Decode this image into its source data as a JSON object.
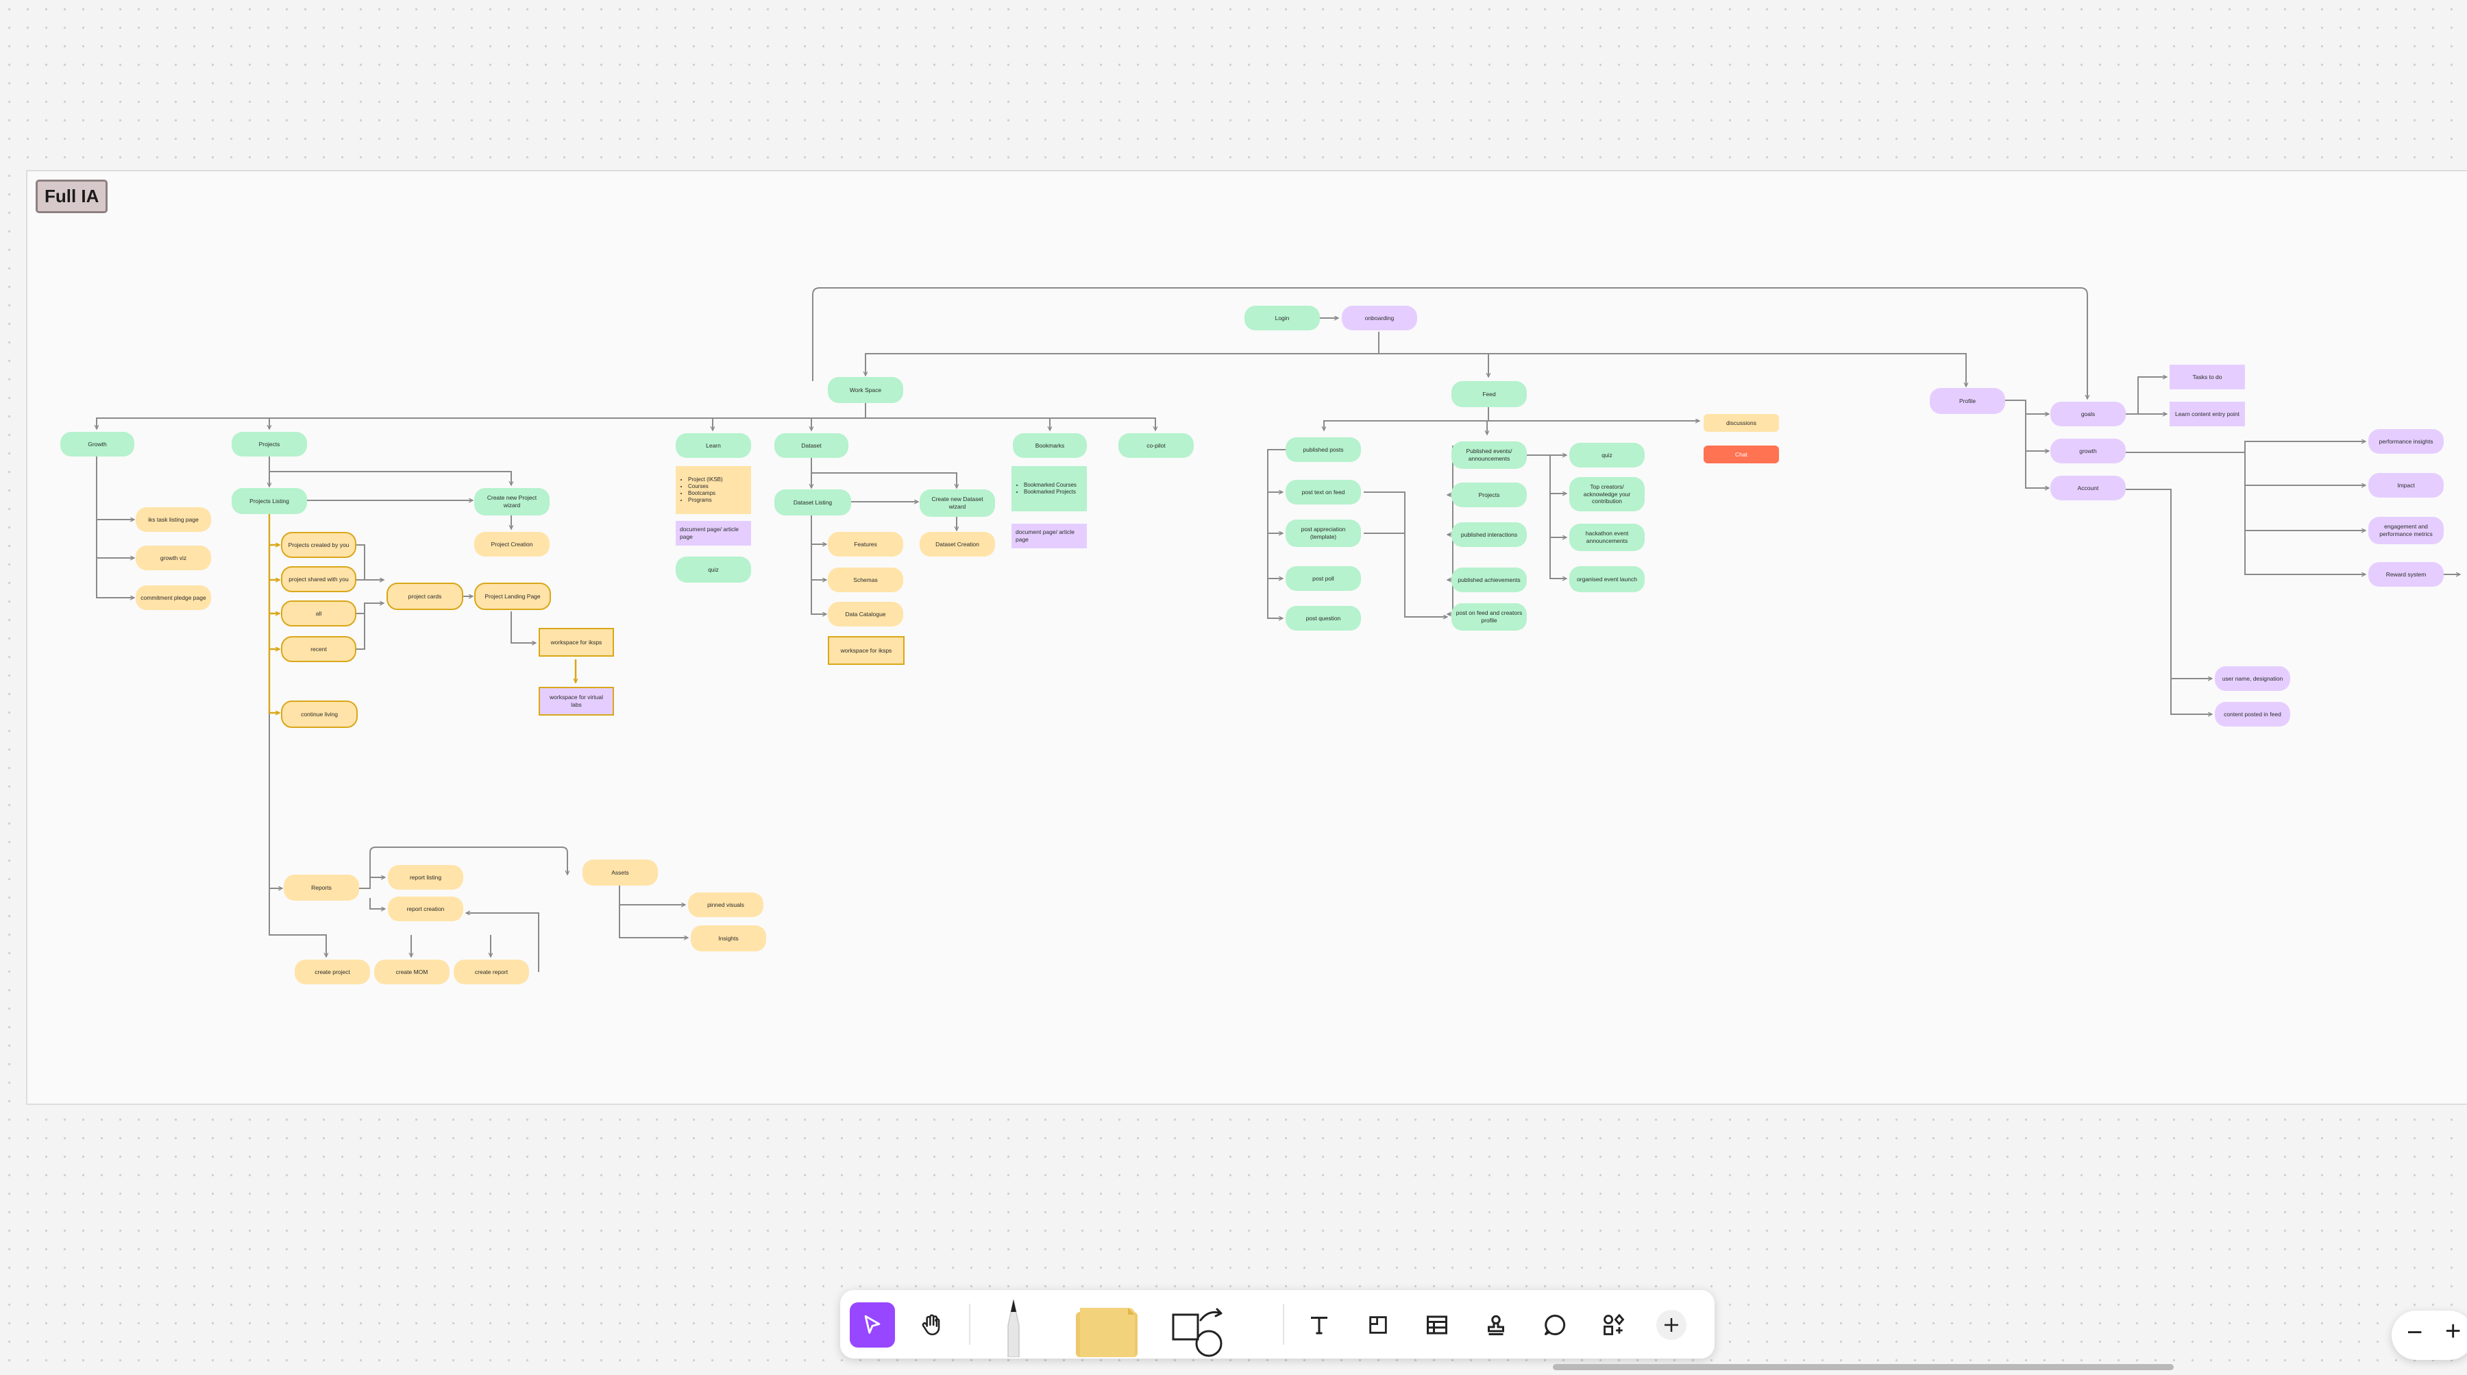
{
  "frame": {
    "title": "Full IA"
  },
  "nodes": {
    "login": "Login",
    "onboarding": "onboarding",
    "workspace": "Work Space",
    "feed": "Feed",
    "profile": "Profile",
    "growth": "Growth",
    "projects": "Projects",
    "learn": "Learn",
    "dataset": "Dataset",
    "bookmarks": "Bookmarks",
    "copilot": "co-pilot",
    "ikstasklisting": "iks task listing page",
    "growthviz": "growth viz",
    "commitment": "commitment pledge page",
    "projectslisting": "Projects Listing",
    "createproject_wizard": "Create new Project wizard",
    "projectcreation": "Project Creation",
    "createdbyyou": "Projects created by you",
    "sharedwithyou": "project shared with you",
    "all": "all",
    "recent": "recent",
    "projectcards": "project cards",
    "projectlanding": "Project Landing Page",
    "ws_iksps": "workspace for iksps",
    "ws_virtuallabs": "workspace for virtual labs",
    "continueliving": "continue living",
    "learn_list": [
      "Project (IKSB)",
      "Courses",
      "Bootcamps",
      "Programs"
    ],
    "learn_doc": "document page/ article page",
    "learn_quiz": "quiz",
    "datasetlisting": "Dataset Listing",
    "createdataset_wizard": "Create new Dataset wizard",
    "datasetcreation": "Dataset Creation",
    "features": "Features",
    "schemas": "Schemas",
    "datacatalogue": "Data Catalogue",
    "ws_iksps2": "workspace for iksps",
    "bookmarks_list": [
      "Bookmarked Courses",
      "Bookmarked Projects"
    ],
    "bookmarks_doc": "document page/ article page",
    "reports": "Reports",
    "reportlisting": "report listing",
    "reportcreation": "report creation",
    "assets": "Assets",
    "pinnedvisuals": "pinned visuals",
    "insights": "Insights",
    "createproject": "create project",
    "createmom": "create MOM",
    "createreport": "create report",
    "publishedposts": "published posts",
    "posttextonfeed": "post text on feed",
    "postappreciation": "post appreciation (template)",
    "postpoll": "post poll",
    "postquestion": "post question",
    "publishedevents": "Published events/ announcements",
    "feedprojects": "Projects",
    "publishedinteractions": "published interactions",
    "publishedachievements": "published achievements",
    "postonfeed": "post on feed and creators profile",
    "feedquiz": "quiz",
    "topcreators": "Top creators/ acknowledge your contribution",
    "hackathon": "hackathon event announcements",
    "organisedevent": "organised event launch",
    "discussions": "discussions",
    "chat": "Chat",
    "goals": "goals",
    "pgrowth": "growth",
    "account": "Account",
    "taskstodo": "Tasks to do",
    "learncontent": "Learn content entry point",
    "perfinsights": "performance insights",
    "impact": "Impact",
    "engagement": "engagement and performance metrics",
    "reward": "Reward system",
    "username": "user name, designation",
    "contentposted": "content posted in feed"
  },
  "colors": {
    "green": "#b5f2cd",
    "purple": "#e5ceff",
    "yellow": "#ffe3a8",
    "red": "#ff7252",
    "accent": "#9747ff"
  },
  "toolbar": {
    "tools": [
      "cursor-icon",
      "hand-icon",
      "pen-icon",
      "sticky-note-icon",
      "shape-icon",
      "text-icon",
      "section-icon",
      "table-icon",
      "stamp-icon",
      "comment-icon",
      "widgets-icon",
      "plus-icon"
    ],
    "active": "cursor-icon"
  },
  "zoom": {
    "minus": "−",
    "plus": "+"
  }
}
